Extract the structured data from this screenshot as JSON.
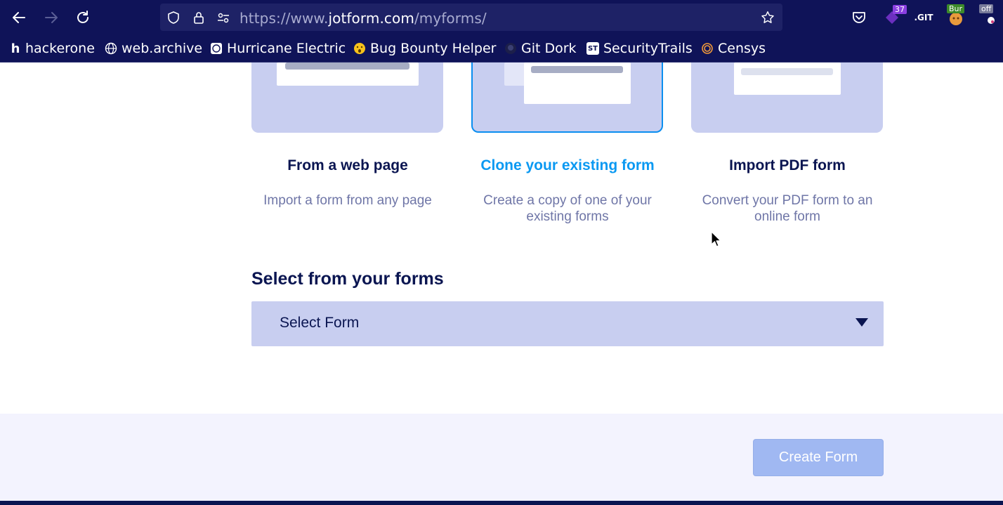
{
  "browser": {
    "url_prefix": "https://www.",
    "url_host": "jotform.com",
    "url_path": "/myforms/",
    "extensions": {
      "counter_badge": "37",
      "git_label": ".GIT",
      "burp_badge": "Bur",
      "off_badge": "off"
    },
    "bookmarks": [
      {
        "label": "hackerone",
        "icon": "hackerone-icon"
      },
      {
        "label": "web.archive",
        "icon": "globe-icon"
      },
      {
        "label": "Hurricane Electric",
        "icon": "he-icon"
      },
      {
        "label": "Bug Bounty Helper",
        "icon": "emoji-icon"
      },
      {
        "label": "Git Dork",
        "icon": "github-icon"
      },
      {
        "label": "SecurityTrails",
        "icon": "securitytrails-icon"
      },
      {
        "label": "Censys",
        "icon": "censys-icon"
      }
    ]
  },
  "options": [
    {
      "title": "From a web page",
      "description": "Import a form from any page",
      "selected": false
    },
    {
      "title": "Clone your existing form",
      "description": "Create a copy of one of your existing forms",
      "selected": true
    },
    {
      "title": "Import PDF form",
      "description": "Convert your PDF form to an online form",
      "selected": false
    }
  ],
  "select_section": {
    "title": "Select from your forms",
    "select_value": "Select Form"
  },
  "footer": {
    "create_button": "Create Form"
  },
  "colors": {
    "chrome_bg": "#0f1358",
    "accent": "#0a99f2",
    "navy": "#0a1551",
    "thumb_bg": "#c8cef0",
    "button_disabled": "#a0b8f2"
  }
}
